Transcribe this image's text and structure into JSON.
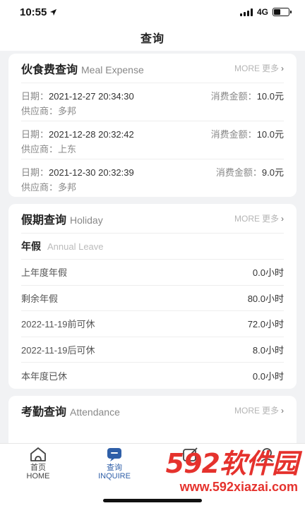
{
  "status": {
    "time": "10:55",
    "network": "4G"
  },
  "nav": {
    "title": "查询"
  },
  "meal": {
    "title": "伙食费查询",
    "title_en": "Meal Expense",
    "more_en": "MORE",
    "more_cn": "更多",
    "date_label": "日期：",
    "supplier_label": "供应商：",
    "amount_label": "消费金额：",
    "records": [
      {
        "date": "2021-12-27 20:34:30",
        "supplier": "多邦",
        "amount": "10.0元"
      },
      {
        "date": "2021-12-28 20:32:42",
        "supplier": "上东",
        "amount": "10.0元"
      },
      {
        "date": "2021-12-30 20:32:39",
        "supplier": "多邦",
        "amount": "9.0元"
      }
    ]
  },
  "holiday": {
    "title": "假期查询",
    "title_en": "Holiday",
    "more_en": "MORE",
    "more_cn": "更多",
    "section": "年假",
    "section_en": "Annual Leave",
    "rows": [
      {
        "label": "上年度年假",
        "value": "0.0小时"
      },
      {
        "label": "剩余年假",
        "value": "80.0小时"
      },
      {
        "label": "2022-11-19前可休",
        "value": "72.0小时"
      },
      {
        "label": "2022-11-19后可休",
        "value": "8.0小时"
      },
      {
        "label": "本年度已休",
        "value": "0.0小时"
      }
    ]
  },
  "attendance": {
    "title": "考勤查询",
    "title_en": "Attendance",
    "more_en": "MORE",
    "more_cn": "更多"
  },
  "tabs": [
    {
      "label": "首页",
      "label_en": "HOME",
      "icon": "home-icon",
      "active": false
    },
    {
      "label": "查询",
      "label_en": "INQUIRE",
      "icon": "chat-icon",
      "active": true
    },
    {
      "label": "",
      "label_en": "",
      "icon": "edit-icon",
      "active": false
    },
    {
      "label": "",
      "label_en": "",
      "icon": "profile-icon",
      "active": false
    }
  ],
  "watermark": {
    "logo": "592软件园",
    "url": "www.592xiazai.com"
  },
  "colors": {
    "accent": "#2f5fa8",
    "watermark": "#e5322d"
  }
}
